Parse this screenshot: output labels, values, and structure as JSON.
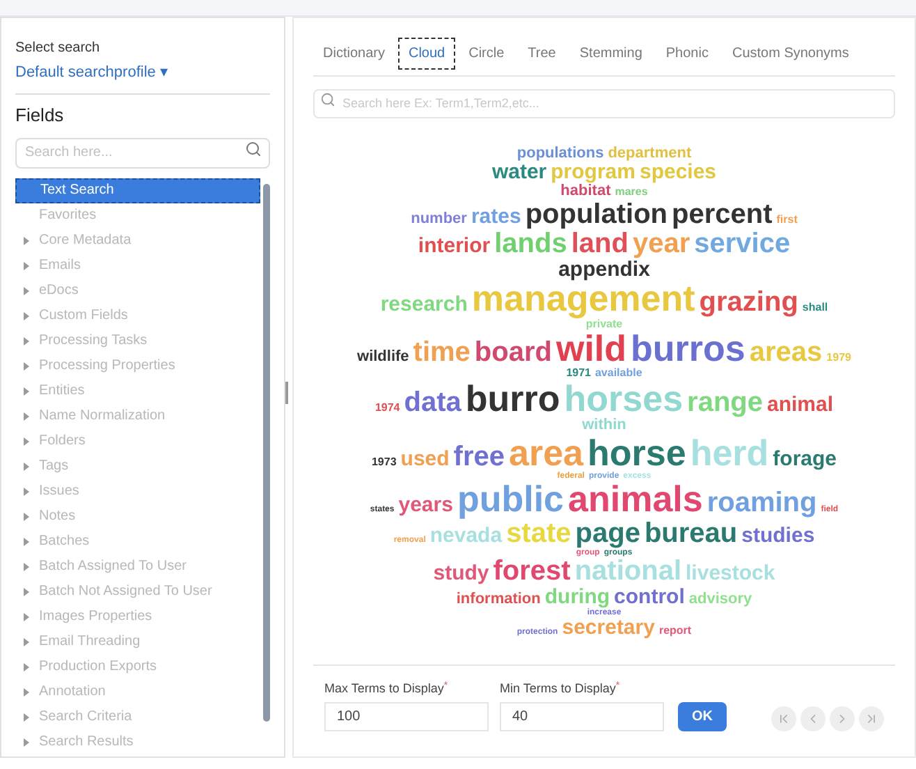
{
  "sidebar": {
    "select_label": "Select search",
    "profile": "Default searchprofile ▾",
    "fields_title": "Fields",
    "search": {
      "placeholder": "Search here..."
    },
    "items": [
      {
        "label": "Text Search",
        "selected": true,
        "expandable": false
      },
      {
        "label": "Favorites",
        "selected": false,
        "expandable": false
      },
      {
        "label": "Core Metadata",
        "selected": false,
        "expandable": true
      },
      {
        "label": "Emails",
        "selected": false,
        "expandable": true
      },
      {
        "label": "eDocs",
        "selected": false,
        "expandable": true
      },
      {
        "label": "Custom Fields",
        "selected": false,
        "expandable": true
      },
      {
        "label": "Processing Tasks",
        "selected": false,
        "expandable": true
      },
      {
        "label": "Processing Properties",
        "selected": false,
        "expandable": true
      },
      {
        "label": "Entities",
        "selected": false,
        "expandable": true
      },
      {
        "label": "Name Normalization",
        "selected": false,
        "expandable": true
      },
      {
        "label": "Folders",
        "selected": false,
        "expandable": true
      },
      {
        "label": "Tags",
        "selected": false,
        "expandable": true
      },
      {
        "label": "Issues",
        "selected": false,
        "expandable": true
      },
      {
        "label": "Notes",
        "selected": false,
        "expandable": true
      },
      {
        "label": "Batches",
        "selected": false,
        "expandable": true
      },
      {
        "label": "Batch Assigned To User",
        "selected": false,
        "expandable": true
      },
      {
        "label": "Batch Not Assigned To User",
        "selected": false,
        "expandable": true
      },
      {
        "label": "Images Properties",
        "selected": false,
        "expandable": true
      },
      {
        "label": "Email Threading",
        "selected": false,
        "expandable": true
      },
      {
        "label": "Production Exports",
        "selected": false,
        "expandable": true
      },
      {
        "label": "Annotation",
        "selected": false,
        "expandable": true
      },
      {
        "label": "Search Criteria",
        "selected": false,
        "expandable": true
      },
      {
        "label": "Search Results",
        "selected": false,
        "expandable": true
      }
    ]
  },
  "tabs": [
    {
      "label": "Dictionary",
      "selected": false
    },
    {
      "label": "Cloud",
      "selected": true
    },
    {
      "label": "Circle",
      "selected": false
    },
    {
      "label": "Tree",
      "selected": false
    },
    {
      "label": "Stemming",
      "selected": false
    },
    {
      "label": "Phonic",
      "selected": false
    },
    {
      "label": "Custom Synonyms",
      "selected": false
    }
  ],
  "term_search": {
    "placeholder": "Search here Ex: Term1,Term2,etc..."
  },
  "cloud_rows": [
    [
      {
        "text": "populations",
        "kind": "sm",
        "color": "#6b8fd6"
      },
      {
        "text": "department",
        "kind": "sm",
        "color": "#e0c040"
      }
    ],
    [
      {
        "text": "water",
        "kind": "md",
        "color": "#2a8a80"
      },
      {
        "text": "program",
        "kind": "md",
        "color": "#e0c840"
      },
      {
        "text": "species",
        "kind": "md",
        "color": "#e0c840"
      }
    ],
    [
      {
        "text": "habitat",
        "kind": "sm",
        "color": "#d04a70"
      },
      {
        "text": "mares",
        "kind": "xs",
        "color": "#7ed07e"
      }
    ],
    [
      {
        "text": "number",
        "kind": "sm",
        "color": "#8080d8"
      },
      {
        "text": "rates",
        "kind": "md",
        "color": "#70a0e0"
      },
      {
        "text": "population",
        "kind": "lg",
        "color": "#333333"
      },
      {
        "text": "percent",
        "kind": "lg",
        "color": "#333333"
      },
      {
        "text": "first",
        "kind": "xs",
        "color": "#f0a050"
      }
    ],
    [
      {
        "text": "interior",
        "kind": "md",
        "color": "#e05050"
      },
      {
        "text": "lands",
        "kind": "lg",
        "color": "#70d070"
      },
      {
        "text": "land",
        "kind": "lg",
        "color": "#e05058"
      },
      {
        "text": "year",
        "kind": "lg",
        "color": "#f0a050"
      },
      {
        "text": "service",
        "kind": "lg",
        "color": "#70a8e0"
      }
    ],
    [
      {
        "text": "appendix",
        "kind": "md",
        "color": "#333333"
      }
    ],
    [
      {
        "text": "research",
        "kind": "md",
        "color": "#80d880"
      },
      {
        "text": "management",
        "kind": "xl",
        "color": "#e8c840"
      },
      {
        "text": "grazing",
        "kind": "lg",
        "color": "#e05050"
      },
      {
        "text": "shall",
        "kind": "xs",
        "color": "#2a8a80"
      }
    ],
    [
      {
        "text": "private",
        "kind": "xs",
        "color": "#90e090"
      }
    ],
    [
      {
        "text": "wildlife",
        "kind": "sm",
        "color": "#333333"
      },
      {
        "text": "time",
        "kind": "lg",
        "color": "#f0a050"
      },
      {
        "text": "board",
        "kind": "lg",
        "color": "#d04a70"
      },
      {
        "text": "wild",
        "kind": "xl",
        "color": "#e04050"
      },
      {
        "text": "burros",
        "kind": "xl",
        "color": "#6b70d0"
      },
      {
        "text": "areas",
        "kind": "lg",
        "color": "#e8c840"
      },
      {
        "text": "1979",
        "kind": "xs",
        "color": "#e8c840"
      }
    ],
    [
      {
        "text": "1971",
        "kind": "xs",
        "color": "#2a8a80"
      },
      {
        "text": "available",
        "kind": "xs",
        "color": "#70a0e0"
      }
    ],
    [
      {
        "text": "1974",
        "kind": "xs",
        "color": "#e05050"
      },
      {
        "text": "data",
        "kind": "lg",
        "color": "#7070d0"
      },
      {
        "text": "burro",
        "kind": "xl",
        "color": "#333333"
      },
      {
        "text": "horses",
        "kind": "xl",
        "color": "#90d8d0"
      },
      {
        "text": "range",
        "kind": "lg",
        "color": "#80d880"
      },
      {
        "text": "animal",
        "kind": "md",
        "color": "#e05050"
      }
    ],
    [
      {
        "text": "within",
        "kind": "sm",
        "color": "#90d8d0"
      }
    ],
    [
      {
        "text": "1973",
        "kind": "xs",
        "color": "#333333"
      },
      {
        "text": "used",
        "kind": "md",
        "color": "#f0a050"
      },
      {
        "text": "free",
        "kind": "lg",
        "color": "#7070d0"
      },
      {
        "text": "area",
        "kind": "xl",
        "color": "#f0a050"
      },
      {
        "text": "horse",
        "kind": "xl",
        "color": "#2a7a70"
      },
      {
        "text": "herd",
        "kind": "xl",
        "color": "#a8e0e0"
      },
      {
        "text": "forage",
        "kind": "md",
        "color": "#2a7a70"
      }
    ],
    [
      {
        "text": "federal",
        "kind": "xxs",
        "color": "#e8a040"
      },
      {
        "text": "provide",
        "kind": "xxs",
        "color": "#70a0e0"
      },
      {
        "text": "excess",
        "kind": "xxs",
        "color": "#a8e0e0"
      }
    ],
    [
      {
        "text": "states",
        "kind": "xxs",
        "color": "#333333"
      },
      {
        "text": "years",
        "kind": "md",
        "color": "#e05878"
      },
      {
        "text": "public",
        "kind": "xl",
        "color": "#70a0e0"
      },
      {
        "text": "animals",
        "kind": "xl",
        "color": "#e04870"
      },
      {
        "text": "roaming",
        "kind": "lg",
        "color": "#70a0e0"
      },
      {
        "text": "field",
        "kind": "xxs",
        "color": "#e05050"
      }
    ],
    [
      {
        "text": "removal",
        "kind": "xxs",
        "color": "#f0a050"
      },
      {
        "text": "nevada",
        "kind": "md",
        "color": "#a8e0e0"
      },
      {
        "text": "state",
        "kind": "lg",
        "color": "#e8d840"
      },
      {
        "text": "page",
        "kind": "lg",
        "color": "#2a7a70"
      },
      {
        "text": "bureau",
        "kind": "lg",
        "color": "#2a7a70"
      },
      {
        "text": "studies",
        "kind": "md",
        "color": "#7070d0"
      }
    ],
    [
      {
        "text": "group",
        "kind": "xxs",
        "color": "#e05878"
      },
      {
        "text": "groups",
        "kind": "xxs",
        "color": "#2a7a70"
      }
    ],
    [
      {
        "text": "study",
        "kind": "md",
        "color": "#e05878"
      },
      {
        "text": "forest",
        "kind": "lg",
        "color": "#e04870"
      },
      {
        "text": "national",
        "kind": "lg",
        "color": "#a8e0e0"
      },
      {
        "text": "livestock",
        "kind": "md",
        "color": "#a8e0e0"
      }
    ],
    [
      {
        "text": "information",
        "kind": "sm",
        "color": "#e05050"
      },
      {
        "text": "during",
        "kind": "md",
        "color": "#80d880"
      },
      {
        "text": "control",
        "kind": "md",
        "color": "#7070d0"
      },
      {
        "text": "advisory",
        "kind": "sm",
        "color": "#90e090"
      }
    ],
    [
      {
        "text": "increase",
        "kind": "xxs",
        "color": "#7070d0"
      }
    ],
    [
      {
        "text": "protection",
        "kind": "xxs",
        "color": "#7070d0"
      },
      {
        "text": "secretary",
        "kind": "md",
        "color": "#f0a050"
      },
      {
        "text": "report",
        "kind": "xs",
        "color": "#e05878"
      }
    ]
  ],
  "max_terms": {
    "label": "Max Terms to Display",
    "required": "*",
    "value": "100"
  },
  "min_terms": {
    "label": "Min Terms to Display",
    "required": "*",
    "value": "40"
  },
  "ok_button": "OK",
  "pager": [
    {
      "kind": "first",
      "disabled": true
    },
    {
      "kind": "prev",
      "disabled": true
    },
    {
      "kind": "next",
      "disabled": true
    },
    {
      "kind": "last",
      "disabled": true
    }
  ]
}
